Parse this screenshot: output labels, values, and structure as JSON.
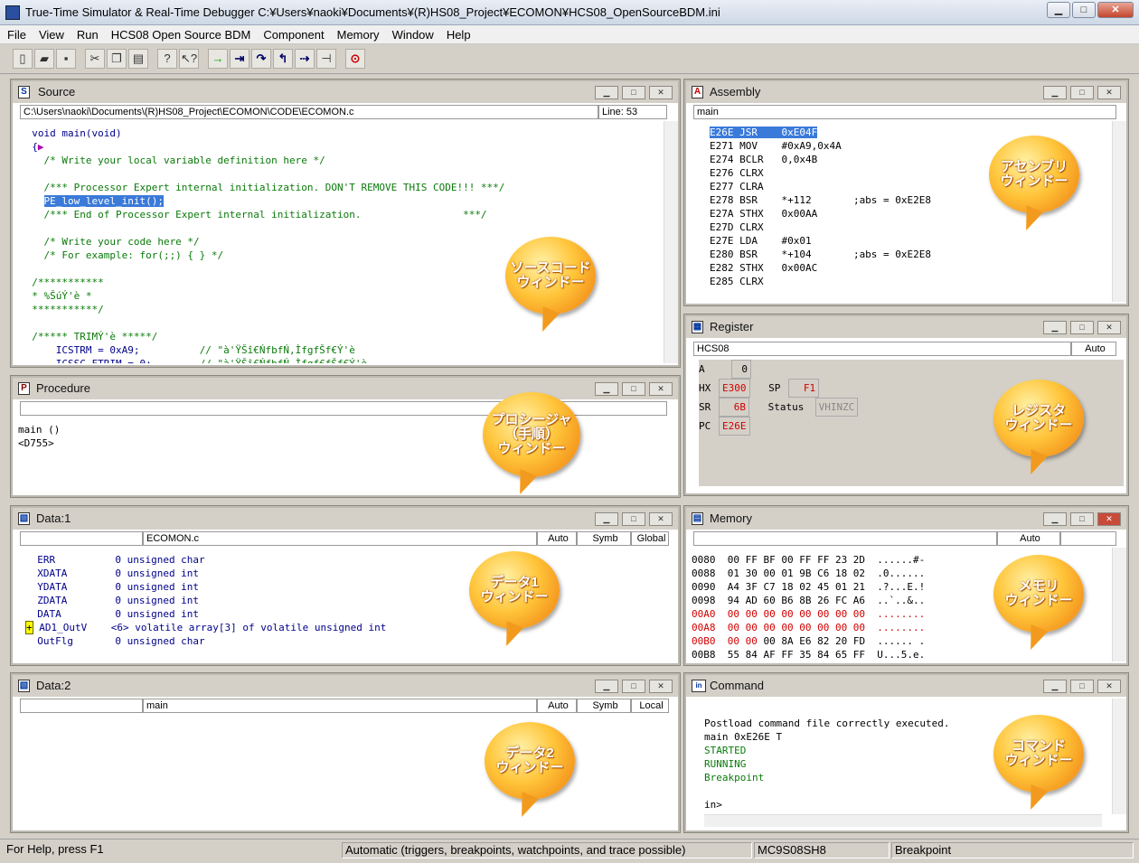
{
  "window_title": "True-Time Simulator & Real-Time Debugger    C:¥Users¥naoki¥Documents¥(R)HS08_Project¥ECOMON¥HCS08_OpenSourceBDM.ini",
  "menu": [
    "File",
    "View",
    "Run",
    "HCS08 Open Source BDM",
    "Component",
    "Memory",
    "Window",
    "Help"
  ],
  "toolbar_numbers": [
    "①",
    "②",
    "③",
    "④",
    "⑤",
    "⑥",
    "⑦"
  ],
  "source": {
    "title": "Source",
    "path": "C:\\Users\\naoki\\Documents\\(R)HS08_Project\\ECOMON\\CODE\\ECOMON.c",
    "line": "Line: 53",
    "bubble": "ソースコード\nウィンドー"
  },
  "assembly": {
    "title": "Assembly",
    "field": "main",
    "bubble": "アセンブリ\nウィンドー"
  },
  "procedure": {
    "title": "Procedure",
    "lines": [
      "main ()",
      "<D755>"
    ],
    "bubble": "プロシージャ\n（手順）\nウィンドー"
  },
  "register": {
    "title": "Register",
    "cpu": "HCS08",
    "mode": "Auto",
    "A_label": "A",
    "A": "0",
    "HX_label": "HX",
    "HX": "E300",
    "SP_label": "SP",
    "SP": "F1",
    "SR_label": "SR",
    "SR": "6B",
    "Status_label": "Status",
    "Status": "VHINZC",
    "PC_label": "PC",
    "PC": "E26E",
    "bubble": "レジスタ\nウィンドー"
  },
  "data1": {
    "title": "Data:1",
    "file": "ECOMON.c",
    "mode": "Auto",
    "fmt": "Symb",
    "scope": "Global",
    "bubble": "データ1\nウィンドー"
  },
  "memory": {
    "title": "Memory",
    "mode": "Auto",
    "bubble": "メモリ\nウィンドー"
  },
  "data2": {
    "title": "Data:2",
    "field": "main",
    "mode": "Auto",
    "fmt": "Symb",
    "scope": "Local",
    "bubble": "データ2\nウィンドー"
  },
  "command": {
    "title": "Command",
    "lines": [
      "Postload command file correctly executed.",
      "main 0xE26E T",
      "STARTED",
      "RUNNING",
      "Breakpoint",
      "",
      "in>"
    ],
    "bubble": "コマンド\nウィンドー"
  },
  "status": {
    "help": "For Help, press F1",
    "mode": "Automatic (triggers, breakpoints, watchpoints, and trace possible)",
    "chip": "MC9S08SH8",
    "state": "Breakpoint"
  }
}
